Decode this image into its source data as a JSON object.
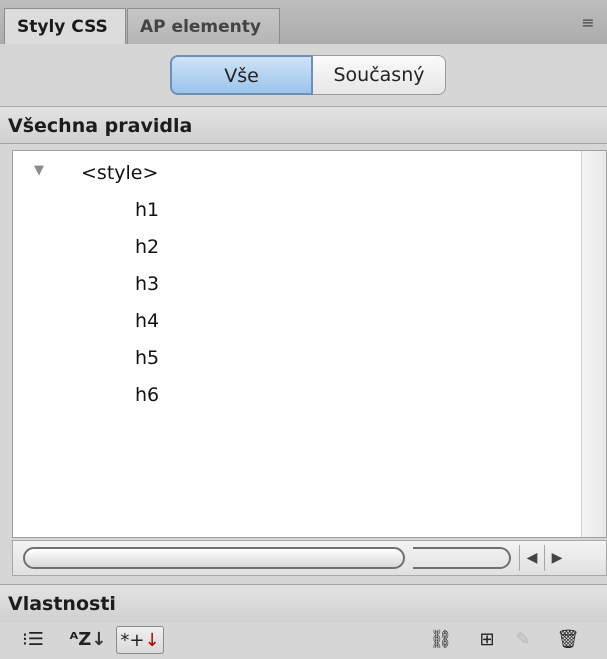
{
  "tabs": [
    {
      "label": "Styly CSS",
      "active": true
    },
    {
      "label": "AP elementy",
      "active": false
    }
  ],
  "panel_menu_icon": "≡",
  "segmented": {
    "left_label": "Vše",
    "right_label": "Současný",
    "selected": "Vše"
  },
  "rules_section": {
    "title": "Všechna pravidla",
    "root": "<style>",
    "children": [
      "h1",
      "h2",
      "h3",
      "h4",
      "h5",
      "h6"
    ]
  },
  "properties_section": {
    "title": "Vlastnosti"
  },
  "toolbar": {
    "category_view_icon": "⁝☰",
    "alpha_view_glyph": "ᴬZ",
    "alpha_arrow": "↓",
    "set_props_glyph": "*+",
    "set_props_arrow": "↓",
    "link_icon": "⛓",
    "new_rule_icon": "⊞",
    "edit_icon": "✎",
    "trash_icon": "🗑"
  },
  "colors": {
    "selected_segment": "#9cc4ec",
    "panel_bg": "#d6d6d6"
  }
}
